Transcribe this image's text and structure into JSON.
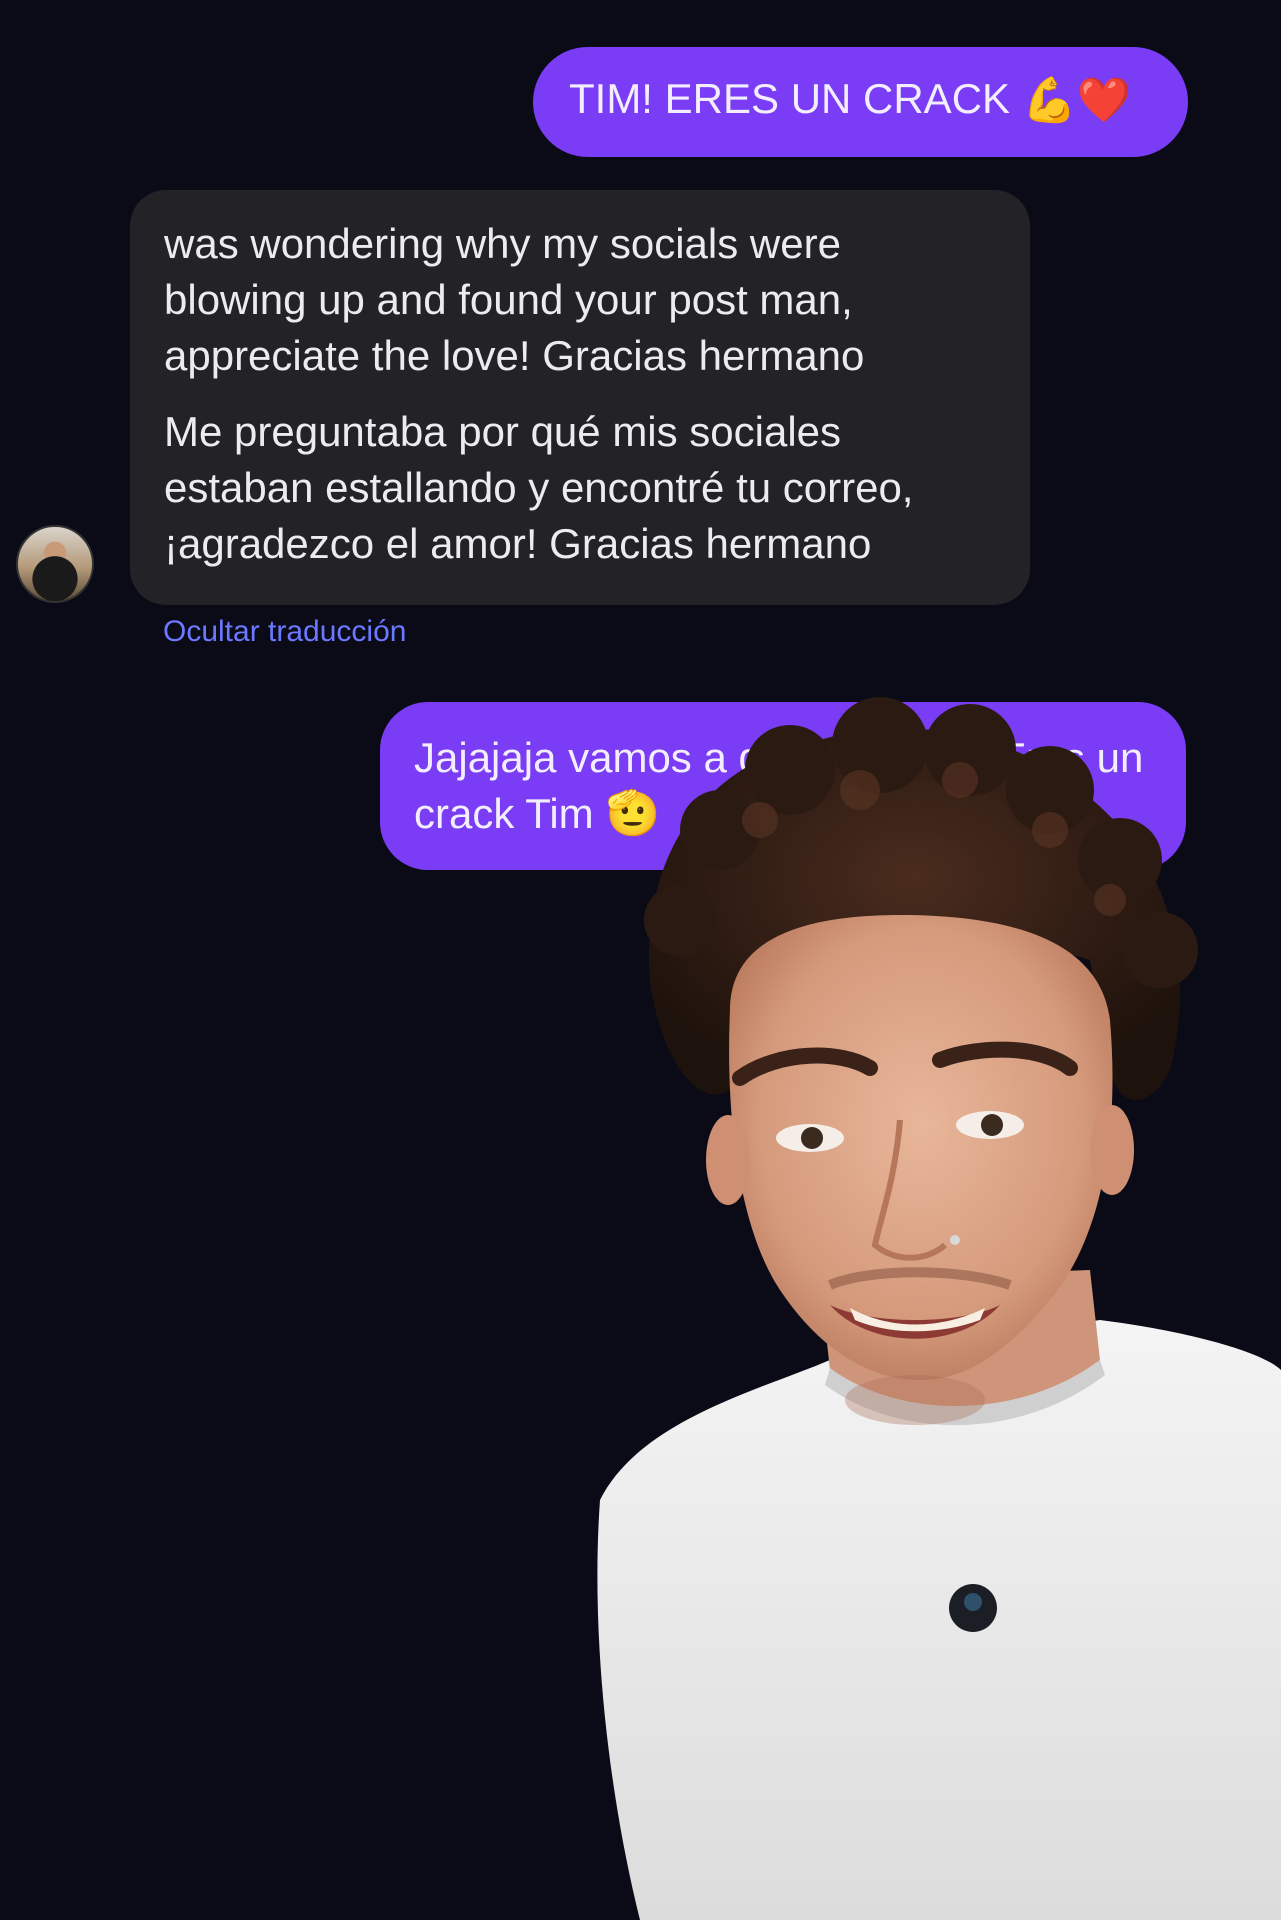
{
  "chat": {
    "messages": [
      {
        "direction": "outgoing",
        "text": "TIM! ERES UN CRACK",
        "emojis": [
          "💪",
          "❤️"
        ]
      },
      {
        "direction": "incoming",
        "original": "was wondering why my socials were blowing up and found your post man, appreciate the love! Gracias hermano",
        "translation": "Me preguntaba por qué mis sociales estaban estallando y encontré tu correo, ¡agradezco el amor! Gracias hermano"
      },
      {
        "direction": "outgoing",
        "text": "Jajajaja vamos a da",
        "text_continued": "! Eres un",
        "line2": "crack Tim",
        "emoji": "🫡"
      }
    ],
    "hide_translation_label": "Ocultar traducción"
  },
  "colors": {
    "background": "#0b0b18",
    "outgoing_bubble": "#7a3cf4",
    "incoming_bubble": "#222227",
    "link": "#6b78ff"
  }
}
